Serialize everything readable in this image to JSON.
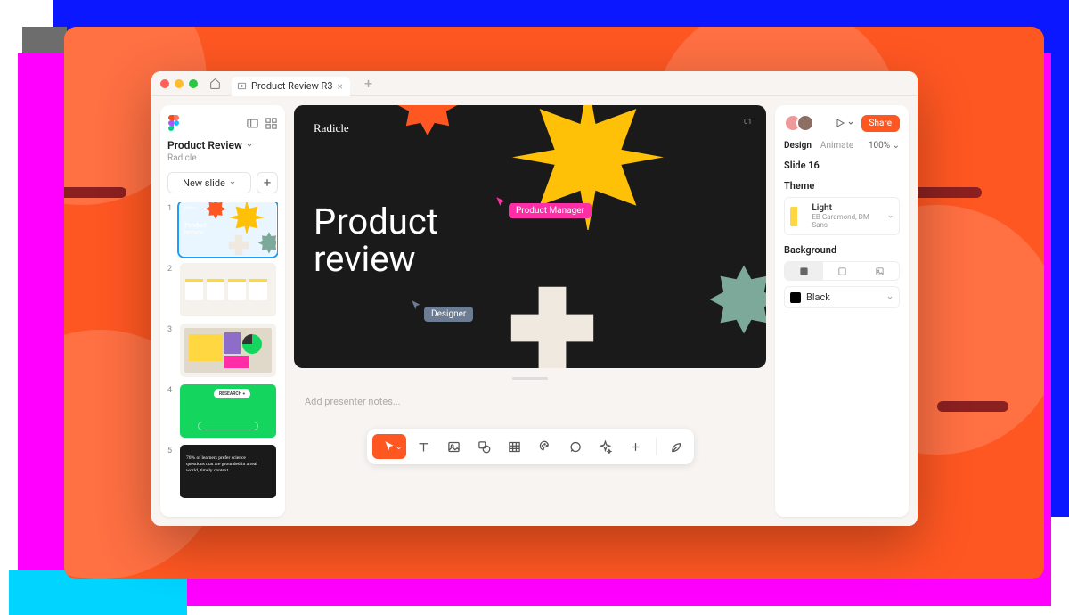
{
  "titlebar": {
    "tab_title": "Product Review R3"
  },
  "left_panel": {
    "doc_title": "Product Review",
    "doc_subtitle": "Radicle",
    "new_slide_label": "New slide",
    "thumbs": [
      {
        "num": "1",
        "title": "Product review"
      },
      {
        "num": "2",
        "title": ""
      },
      {
        "num": "3",
        "title": ""
      },
      {
        "num": "4",
        "badge": "RESEARCH"
      },
      {
        "num": "5",
        "text": "76% of learners prefer science questions that are grounded in a real world, timely context."
      }
    ]
  },
  "slide": {
    "brand": "Radicle",
    "number": "01",
    "title_line1": "Product",
    "title_line2": "review",
    "cursor_pm": "Product Manager",
    "cursor_designer": "Designer"
  },
  "notes": {
    "placeholder": "Add presenter notes..."
  },
  "right_panel": {
    "share_label": "Share",
    "tabs": {
      "design": "Design",
      "animate": "Animate"
    },
    "zoom": "100%",
    "slide_label": "Slide 16",
    "theme_label": "Theme",
    "theme_name": "Light",
    "theme_fonts": "EB Garamond, DM Sans",
    "background_label": "Background",
    "bg_color_name": "Black"
  },
  "colors": {
    "accent": "#ff5722",
    "pm_cursor": "#ff2ea6",
    "designer_cursor": "#6b7c93"
  }
}
